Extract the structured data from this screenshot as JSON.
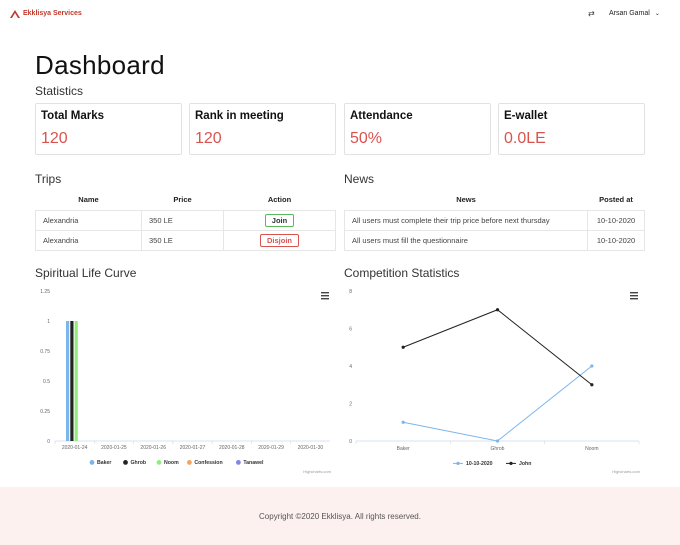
{
  "brand": {
    "name": "Ekklisya Services"
  },
  "user": {
    "name": "Arsan Gamal"
  },
  "page": {
    "title": "Dashboard",
    "statistics_label": "Statistics"
  },
  "stats": [
    {
      "label": "Total Marks",
      "value": "120"
    },
    {
      "label": "Rank in meeting",
      "value": "120"
    },
    {
      "label": "Attendance",
      "value": "50%"
    },
    {
      "label": "E-wallet",
      "value": "0.0LE"
    }
  ],
  "trips": {
    "title": "Trips",
    "columns": [
      "Name",
      "Price",
      "Action"
    ],
    "rows": [
      {
        "name": "Alexandria",
        "price": "350 LE",
        "action": "Join"
      },
      {
        "name": "Alexandria",
        "price": "350 LE",
        "action": "Disjoin"
      }
    ]
  },
  "news": {
    "title": "News",
    "columns": [
      "News",
      "Posted at"
    ],
    "rows": [
      {
        "text": "All users must complete their trip price before next thursday",
        "posted": "10-10-2020"
      },
      {
        "text": "All users must fill the questionnaire",
        "posted": "10-10-2020"
      }
    ]
  },
  "charts": {
    "spiritual_title": "Spiritual Life Curve",
    "competition_title": "Competition Statistics",
    "menu_icon": "hamburger-menu-icon",
    "credit": "Highcharts.com"
  },
  "chart_data": [
    {
      "type": "bar",
      "title": "",
      "x": [
        "2020-01-24",
        "2020-01-25",
        "2020-01-26",
        "2020-01-27",
        "2020-01-28",
        "2020-01-29",
        "2020-01-30"
      ],
      "y_ticks": [
        "0",
        "0.25",
        "0.5",
        "0.75",
        "1",
        "1.25"
      ],
      "ylim": [
        0,
        1.25
      ],
      "grid": false,
      "legend": "bottom",
      "series": [
        {
          "name": "Baker",
          "color": "#7cb5ec",
          "values": [
            1,
            null,
            null,
            null,
            null,
            null,
            null
          ]
        },
        {
          "name": "Ghrob",
          "color": "#222222",
          "values": [
            1,
            null,
            null,
            null,
            null,
            null,
            null
          ]
        },
        {
          "name": "Noom",
          "color": "#90ed7d",
          "values": [
            1,
            null,
            null,
            null,
            null,
            null,
            null
          ]
        },
        {
          "name": "Confession",
          "color": "#f7a35c",
          "values": [
            null,
            null,
            null,
            null,
            null,
            null,
            null
          ]
        },
        {
          "name": "Tanawel",
          "color": "#8085e9",
          "values": [
            null,
            null,
            null,
            null,
            null,
            null,
            null
          ]
        }
      ]
    },
    {
      "type": "line",
      "title": "",
      "categories": [
        "Baker",
        "Ghrob",
        "Noom"
      ],
      "y_ticks": [
        "0",
        "2",
        "4",
        "6",
        "8"
      ],
      "ylim": [
        0,
        8
      ],
      "grid": false,
      "legend": "bottom",
      "series": [
        {
          "name": "10-10-2020",
          "color": "#7cb5ec",
          "values": [
            1,
            0,
            4
          ]
        },
        {
          "name": "John",
          "color": "#222222",
          "values": [
            5,
            7,
            3
          ]
        }
      ]
    }
  ],
  "footer": {
    "text": "Copyright ©2020 Ekklisya. All rights reserved."
  }
}
